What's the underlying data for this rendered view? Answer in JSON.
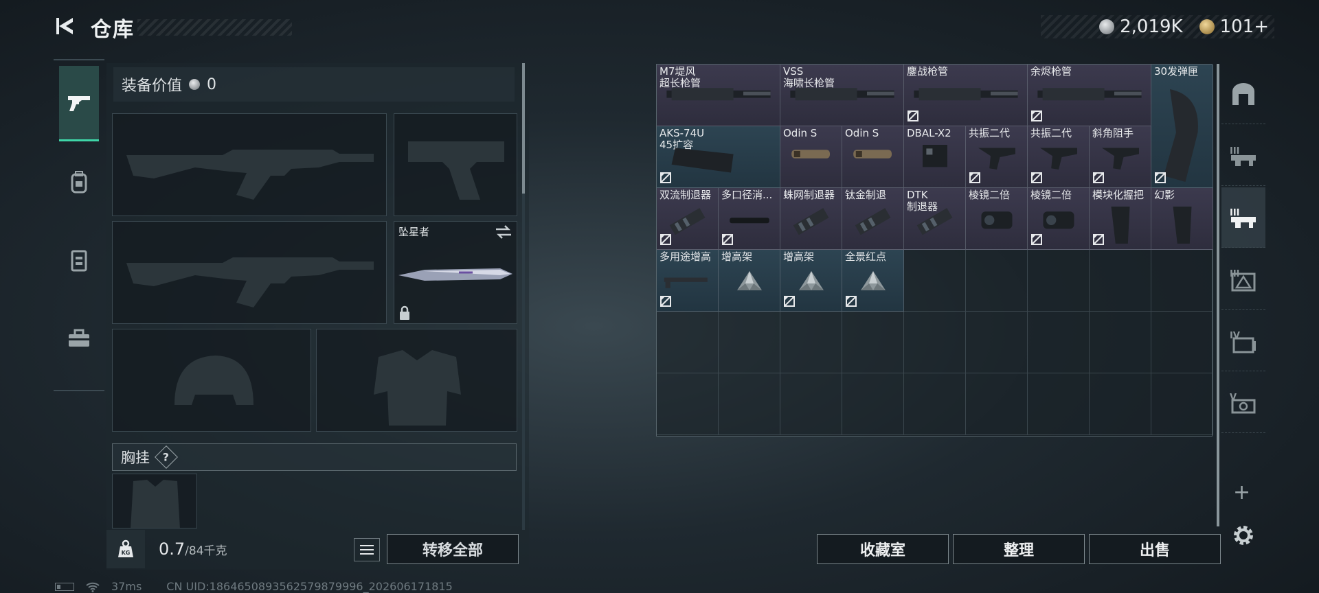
{
  "header": {
    "title": "仓库",
    "currencies": [
      {
        "icon": "silver-coin-icon",
        "value": "2,019K"
      },
      {
        "icon": "gold-coin-icon",
        "value": "101+"
      }
    ]
  },
  "left_tabs": [
    {
      "icon": "gun-icon",
      "active": true
    },
    {
      "icon": "backpack-icon",
      "active": false
    },
    {
      "icon": "vest-icon",
      "active": false
    },
    {
      "icon": "toolbox-icon",
      "active": false
    }
  ],
  "loadout": {
    "equip_value_label": "装备价值",
    "equip_value": "0",
    "melee_name": "坠星者",
    "chest_label": "胸挂",
    "chest_help": "?",
    "weight_current": "0.7",
    "weight_max": "/84千克",
    "transfer_all": "转移全部"
  },
  "storage": {
    "items": [
      {
        "name": "M7堤风\n超长枪管",
        "rarity": "purple",
        "no_trade": false
      },
      {
        "name": "VSS\n海啸长枪管",
        "rarity": "purple",
        "no_trade": false
      },
      {
        "name": "鏖战枪管",
        "rarity": "purple",
        "no_trade": true
      },
      {
        "name": "余烬枪管",
        "rarity": "purple",
        "no_trade": true
      },
      {
        "name": "30发弹匣",
        "rarity": "blue",
        "no_trade": true
      },
      {
        "name": "AKS-74U\n45扩容",
        "rarity": "blue",
        "no_trade": true
      },
      {
        "name": "Odin S",
        "rarity": "purple",
        "no_trade": false
      },
      {
        "name": "Odin S",
        "rarity": "purple",
        "no_trade": false
      },
      {
        "name": "DBAL-X2",
        "rarity": "purple",
        "no_trade": false
      },
      {
        "name": "共振二代",
        "rarity": "purple",
        "no_trade": true
      },
      {
        "name": "共振二代",
        "rarity": "purple",
        "no_trade": true
      },
      {
        "name": "斜角阻手",
        "rarity": "purple",
        "no_trade": true
      },
      {
        "name": "双流制退器",
        "rarity": "purple",
        "no_trade": true
      },
      {
        "name": "多口径消...",
        "rarity": "purple",
        "no_trade": true
      },
      {
        "name": "蛛网制退器",
        "rarity": "purple",
        "no_trade": false
      },
      {
        "name": "钛金制退",
        "rarity": "purple",
        "no_trade": false
      },
      {
        "name": "DTK\n制退器",
        "rarity": "purple",
        "no_trade": false
      },
      {
        "name": "棱镜二倍",
        "rarity": "purple",
        "no_trade": false
      },
      {
        "name": "棱镜二倍",
        "rarity": "purple",
        "no_trade": true
      },
      {
        "name": "模块化握把",
        "rarity": "purple",
        "no_trade": true
      },
      {
        "name": "幻影",
        "rarity": "purple",
        "no_trade": false
      },
      {
        "name": "多用途增高",
        "rarity": "blue",
        "no_trade": true
      },
      {
        "name": "增高架",
        "rarity": "blue",
        "no_trade": false
      },
      {
        "name": "增高架",
        "rarity": "blue",
        "no_trade": true
      },
      {
        "name": "全景红点",
        "rarity": "blue",
        "no_trade": true
      }
    ]
  },
  "right_tabs": [
    {
      "icon": "home-storage-icon",
      "active": false
    },
    {
      "icon": "storage-3-icon",
      "active": false
    },
    {
      "icon": "storage-3b-icon",
      "active": true
    },
    {
      "icon": "storage-3c-icon",
      "active": false
    },
    {
      "icon": "storage-4-icon",
      "active": false
    },
    {
      "icon": "storage-5-icon",
      "active": false
    }
  ],
  "actions": {
    "collection": "收藏室",
    "organize": "整理",
    "sell": "出售"
  },
  "status": {
    "ping": "37ms",
    "uid": "CN UID:1864650893562579879996_202606171815"
  }
}
